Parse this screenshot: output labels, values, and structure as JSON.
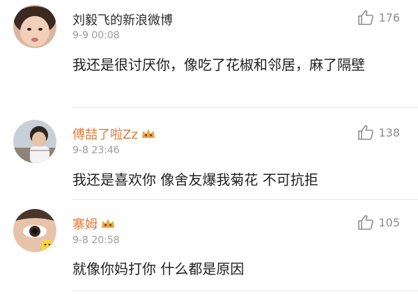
{
  "comments": [
    {
      "username": "刘毅飞的新浪微博",
      "time": "9-9 00:08",
      "text": "我还是很讨厌你，像吃了花椒和邻居，麻了隔壁",
      "likes": "176",
      "username_color": "#2c2c2c"
    },
    {
      "username": "傅喆了啦Zz",
      "time": "9-8 23:46",
      "text": "我还是喜欢你 像舍友爆我菊花  不可抗拒",
      "likes": "138",
      "username_color": "#e0793a"
    },
    {
      "username": "寨姆",
      "time": "9-8 20:58",
      "text": "就像你妈打你 什么都是原因",
      "likes": "105",
      "username_color": "#e0793a"
    }
  ],
  "icons": {
    "like": "thumbs-up-icon",
    "badge": "vip-crown-icon"
  }
}
